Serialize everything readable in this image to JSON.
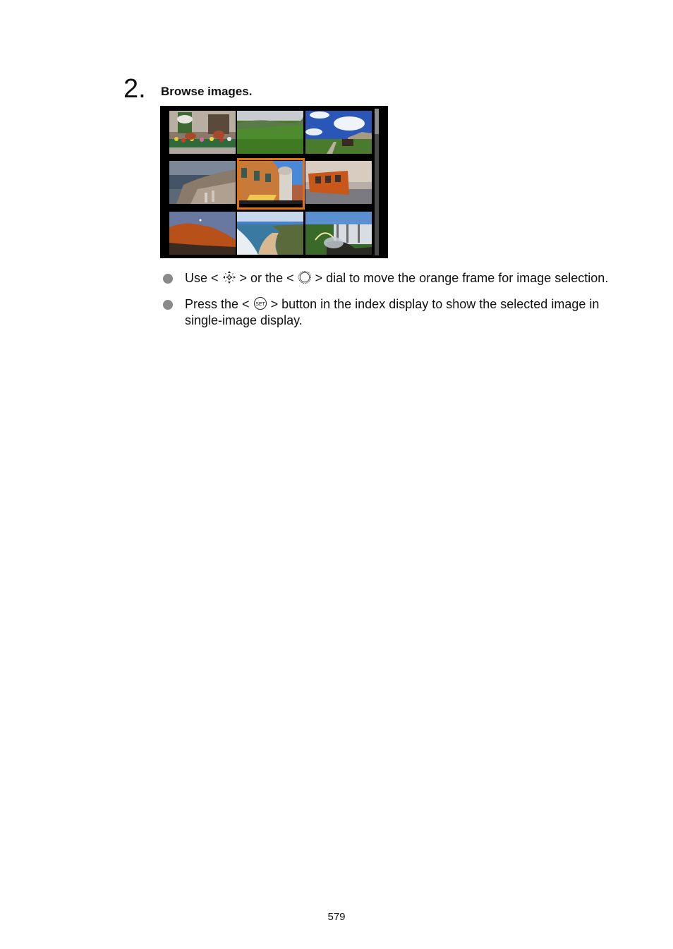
{
  "step": {
    "number": "2.",
    "title": "Browse images."
  },
  "screen": {
    "description": "Index display with 3x3 image thumbnails; center image selected by orange frame",
    "frame_color": "#e4700f",
    "thumbnails": [
      {
        "subject": "storefront-with-flowers",
        "selected": false
      },
      {
        "subject": "green-meadow-hills",
        "selected": false
      },
      {
        "subject": "blue-sky-alpine-hut",
        "selected": false
      },
      {
        "subject": "coastal-city-monaco",
        "selected": false
      },
      {
        "subject": "orange-building-facade",
        "selected": true
      },
      {
        "subject": "orange-tram-street",
        "selected": false
      },
      {
        "subject": "red-cliff-moon",
        "selected": false
      },
      {
        "subject": "beach-coastline",
        "selected": false
      },
      {
        "subject": "waterfall-rainbow",
        "selected": false
      }
    ]
  },
  "bullets": [
    {
      "parts": [
        "Use < ",
        " > or the < ",
        " > dial to move the orange frame for image selection."
      ],
      "icons": [
        "multi-controller-icon",
        "quick-control-dial-icon"
      ]
    },
    {
      "parts": [
        "Press the < ",
        " > button in the index display to show the selected image in single-image display."
      ],
      "icons": [
        "set-button-icon"
      ]
    }
  ],
  "page_number": "579"
}
